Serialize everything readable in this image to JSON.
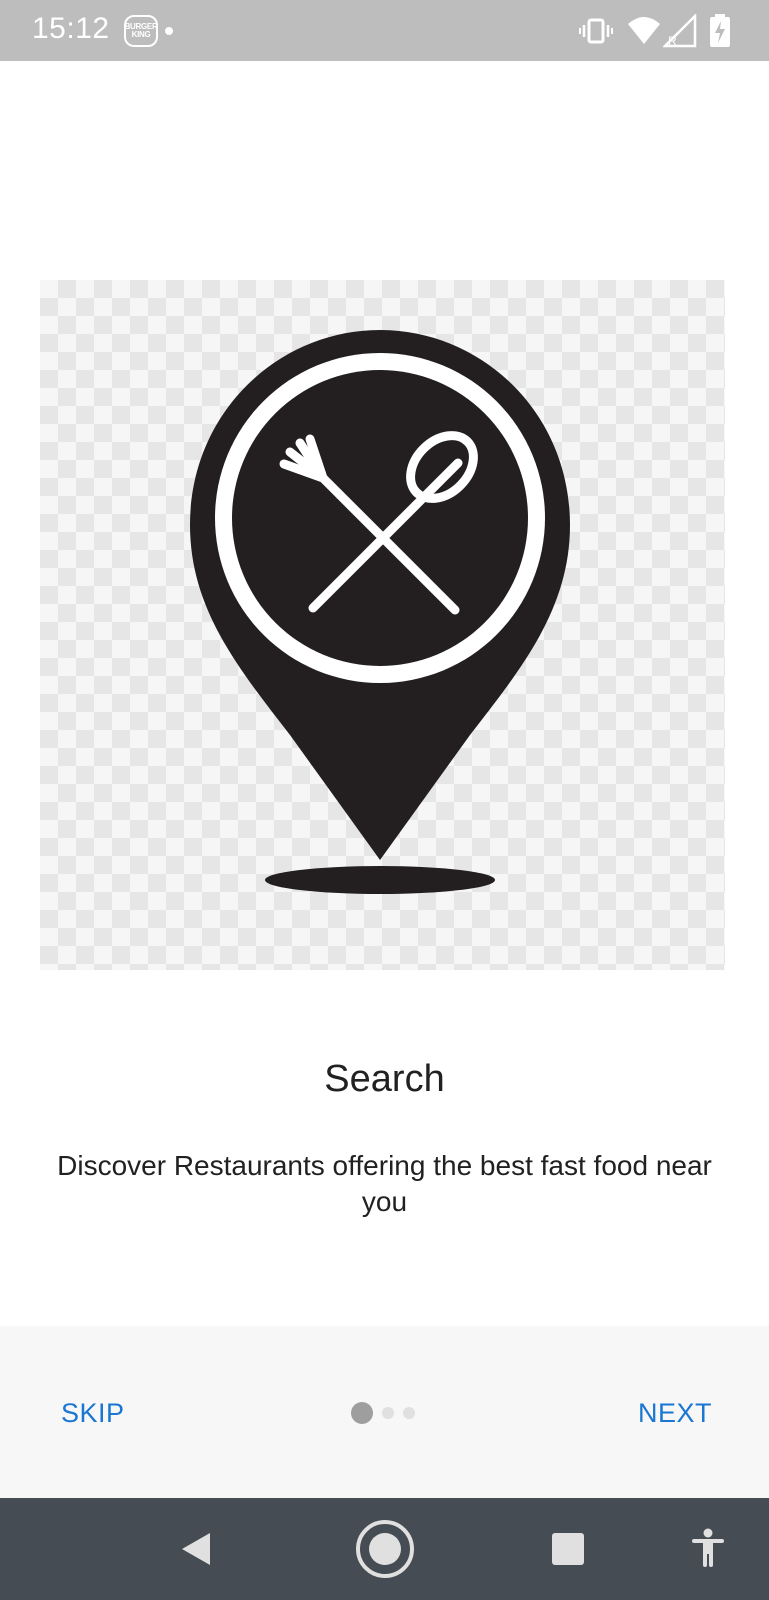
{
  "status_bar": {
    "time": "15:12",
    "app_logo_text_top": "BURGER",
    "app_logo_text_bottom": "KING",
    "icons": [
      "burger-king-notification-icon",
      "notification-dot-icon",
      "vibrate-icon",
      "wifi-icon",
      "signal-roaming-icon",
      "battery-charging-icon"
    ]
  },
  "onboarding": {
    "illustration": "restaurant-location-pin-icon",
    "title": "Search",
    "description": "Discover Restaurants offering the best fast food near you",
    "page_indicator": {
      "current": 1,
      "total": 3
    }
  },
  "bottom_bar": {
    "skip_label": "SKIP",
    "next_label": "NEXT"
  },
  "nav_bar": {
    "icons": [
      "back-icon",
      "home-icon",
      "recents-icon",
      "accessibility-icon"
    ]
  },
  "colors": {
    "status_bar": "#bdbdbd",
    "accent": "#1976d2",
    "nav_bar": "#454c53",
    "bottom_bar": "#f7f7f7",
    "icon_dark": "#231f20"
  }
}
